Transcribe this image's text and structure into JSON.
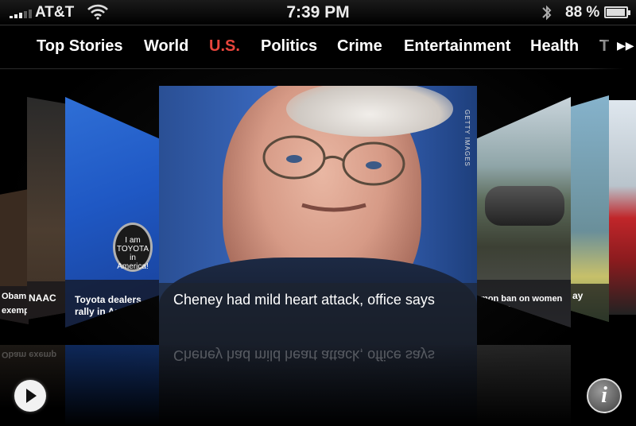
{
  "status_bar": {
    "carrier": "AT&T",
    "time": "7:39 PM",
    "battery_percent": "88 %",
    "battery_level": 0.88
  },
  "categories": {
    "active": "U.S.",
    "tabs": [
      {
        "label": "Top Stories"
      },
      {
        "label": "World"
      },
      {
        "label": "U.S."
      },
      {
        "label": "Politics"
      },
      {
        "label": "Crime"
      },
      {
        "label": "Entertainment"
      },
      {
        "label": "Health"
      },
      {
        "label": "T"
      }
    ]
  },
  "stories": {
    "center": {
      "caption": "Cheney had mild heart attack, office says",
      "photo_credit": "GETTY IMAGES"
    },
    "left": {
      "caption": "Toyota dealers rally in Amer",
      "pin_text": "I am TOYOTA in America!"
    },
    "far_left_1": {
      "caption": "Obam exemp"
    },
    "far_left_2": {
      "caption": "NAAC"
    },
    "right": {
      "caption": "mon ban on women in subs"
    },
    "far_right_1": {
      "caption": "ay"
    }
  },
  "icons": {
    "play": "play-icon",
    "info": "info-icon",
    "wifi": "wifi-icon",
    "bluetooth": "bluetooth-icon"
  },
  "colors": {
    "active_tab": "#e8453c"
  }
}
